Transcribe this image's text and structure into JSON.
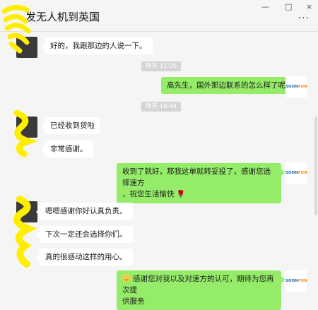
{
  "window": {
    "title": "发无人机到英国",
    "controls": [
      "—",
      "□",
      "×"
    ],
    "more": "···"
  },
  "messages": [
    {
      "type": "in",
      "text": "好的，我跟那边的人说一下。"
    },
    {
      "type": "time",
      "text": "昨天 11:06"
    },
    {
      "type": "out",
      "text": "高先生，国外那边联系的怎么样了呢"
    },
    {
      "type": "time",
      "text": "昨天 16:44"
    },
    {
      "type": "in",
      "text": "已经收到货啦"
    },
    {
      "type": "in",
      "text": "非常感谢。"
    },
    {
      "type": "out",
      "line1": "收到了就好，那我这单就转妥投了，感谢您选择速方",
      "line2": "，祝您生活愉快"
    },
    {
      "type": "in",
      "text": "嗯嗯感谢你好认真负责。"
    },
    {
      "type": "in",
      "text": "下次一定还会选择你们。"
    },
    {
      "type": "in",
      "text": "真的很感动这样的用心。"
    },
    {
      "type": "out",
      "line1": "感谢您对我以及对速方的认可，期待为您再次提",
      "line2": "供服务"
    }
  ],
  "avatar": {
    "brand_a": "SOON",
    "brand_b": "FUN"
  },
  "colors": {
    "outgoing": "#95ec69",
    "incoming": "#ffffff",
    "redaction": "#ffee00"
  }
}
